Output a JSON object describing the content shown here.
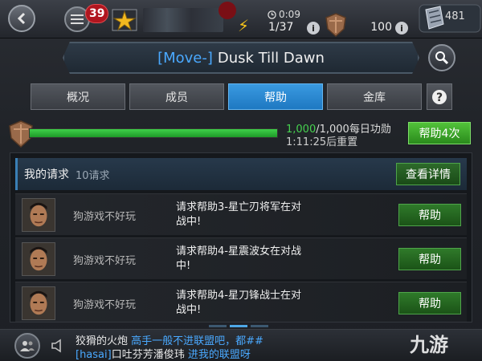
{
  "topbar": {
    "notification_count": "39",
    "timer": "0:09",
    "energy": "1/37",
    "points": "100",
    "crystals": "481",
    "info_glyph": "i"
  },
  "title": {
    "tag": "[Move-]",
    "name": "Dusk Till Dawn"
  },
  "tabs": [
    {
      "label": "概况",
      "active": false
    },
    {
      "label": "成员",
      "active": false
    },
    {
      "label": "帮助",
      "active": true
    },
    {
      "label": "金库",
      "active": false
    }
  ],
  "progress": {
    "current": "1,000",
    "rest": "/1,000每日功勋",
    "fraction": 1.0,
    "reset": "1:11:25后重置",
    "button": "帮助4次"
  },
  "requests": {
    "title": "我的请求",
    "count": "10请求",
    "view_button": "查看详情",
    "items": [
      {
        "name": "狗游戏不好玩",
        "request": "请求帮助3-星亡刃将军在对战中!",
        "button": "帮助"
      },
      {
        "name": "狗游戏不好玩",
        "request": "请求帮助4-星震波女在对战中!",
        "button": "帮助"
      },
      {
        "name": "狗游戏不好玩",
        "request": "请求帮助4-星刀锋战士在对战中!",
        "button": "帮助"
      }
    ]
  },
  "chat": {
    "line1_user": "狡猾的火炮",
    "line1_msg": "高手一般不进联盟吧，都##",
    "line2_tag": "[hasai]",
    "line2_user": "口吐芬芳潘俊玮",
    "line2_msg": "进我的联盟呀"
  },
  "watermark": "九游",
  "colors": {
    "accent_blue": "#2a8ad6",
    "progress_green": "#2fb53a",
    "badge_red": "#b0161f"
  },
  "icons": [
    "back-arrow-icon",
    "menu-icon",
    "alliance-emblem-icon",
    "bolt-icon",
    "clock-icon",
    "info-icon",
    "shield-icon",
    "crystal-icon",
    "search-icon",
    "question-icon",
    "avatar",
    "people-icon",
    "speaker-icon"
  ]
}
